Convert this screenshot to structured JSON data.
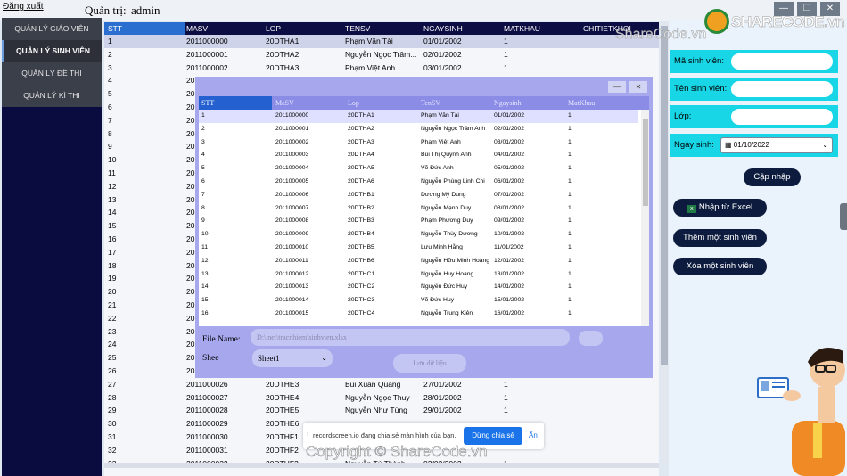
{
  "topbar": {
    "logout": "Đăng xuất",
    "admin_label": "Quản trị:",
    "admin_name": "admin"
  },
  "window_controls": {
    "minimize": "—",
    "restore": "❐",
    "close": "✕"
  },
  "sidebar": {
    "items": [
      {
        "label": "QUẢN LÝ GIÁO VIÊN"
      },
      {
        "label": "QUẢN LÝ SINH VIÊN"
      },
      {
        "label": "QUẢN LÝ ĐỀ THI"
      },
      {
        "label": "QUẢN LÝ KÌ THI"
      }
    ]
  },
  "grid": {
    "columns": [
      "STT",
      "MASV",
      "LOP",
      "TENSV",
      "NGAYSINH",
      "MATKHAU",
      "CHITIETKHOI"
    ],
    "rows": [
      [
        "1",
        "2011000000",
        "20DTHA1",
        "Phạm Văn Tài",
        "01/01/2002",
        "1"
      ],
      [
        "2",
        "2011000001",
        "20DTHA2",
        "Nguyễn Ngọc Trâm...",
        "02/01/2002",
        "1"
      ],
      [
        "3",
        "2011000002",
        "20DTHA3",
        "Phạm Việt Anh",
        "03/01/2002",
        "1"
      ],
      [
        "4",
        "20",
        "",
        "",
        "",
        ""
      ],
      [
        "5",
        "20",
        "",
        "",
        "",
        ""
      ],
      [
        "6",
        "20",
        "",
        "",
        "",
        ""
      ],
      [
        "7",
        "20",
        "",
        "",
        "",
        ""
      ],
      [
        "8",
        "20",
        "",
        "",
        "",
        ""
      ],
      [
        "9",
        "20",
        "",
        "",
        "",
        ""
      ],
      [
        "10",
        "20",
        "",
        "",
        "",
        ""
      ],
      [
        "11",
        "20",
        "",
        "",
        "",
        ""
      ],
      [
        "12",
        "20",
        "",
        "",
        "",
        ""
      ],
      [
        "13",
        "20",
        "",
        "",
        "",
        ""
      ],
      [
        "14",
        "20",
        "",
        "",
        "",
        ""
      ],
      [
        "15",
        "20",
        "",
        "",
        "",
        ""
      ],
      [
        "16",
        "20",
        "",
        "",
        "",
        ""
      ],
      [
        "17",
        "20",
        "",
        "",
        "",
        ""
      ],
      [
        "18",
        "20",
        "",
        "",
        "",
        ""
      ],
      [
        "19",
        "20",
        "",
        "",
        "",
        ""
      ],
      [
        "20",
        "20",
        "",
        "",
        "",
        ""
      ],
      [
        "21",
        "20",
        "",
        "",
        "",
        ""
      ],
      [
        "22",
        "20",
        "",
        "",
        "",
        ""
      ],
      [
        "23",
        "20",
        "",
        "",
        "",
        ""
      ],
      [
        "24",
        "20",
        "",
        "",
        "",
        ""
      ],
      [
        "25",
        "20",
        "",
        "",
        "",
        ""
      ],
      [
        "26",
        "20",
        "",
        "",
        "",
        ""
      ],
      [
        "27",
        "2011000026",
        "20DTHE3",
        "Bùi Xuân Quang",
        "27/01/2002",
        "1"
      ],
      [
        "28",
        "2011000027",
        "20DTHE4",
        "Nguyễn Ngọc Thuy",
        "28/01/2002",
        "1"
      ],
      [
        "29",
        "2011000028",
        "20DTHE5",
        "Nguyễn Như Tùng",
        "29/01/2002",
        "1"
      ],
      [
        "30",
        "2011000029",
        "20DTHE6",
        "",
        "",
        ""
      ],
      [
        "31",
        "2011000030",
        "20DTHF1",
        "",
        "",
        ""
      ],
      [
        "32",
        "2011000031",
        "20DTHF2",
        "",
        "",
        ""
      ],
      [
        "33",
        "2011000032",
        "20DTHF3",
        "Nguyễn Tú Thành",
        "02/02/2002",
        "1"
      ]
    ]
  },
  "form": {
    "masv_label": "Mã sinh viên:",
    "tensv_label": "Tên sinh viên:",
    "lop_label": "Lớp:",
    "ngaysinh_label": "Ngày sinh:",
    "ngaysinh_value": "01/10/2022",
    "update_button": "Cập nhập",
    "import_excel_button": "Nhập từ Excel",
    "add_button": "Thêm một sinh viên",
    "delete_button": "Xóa một sinh viên"
  },
  "dialog": {
    "columns": [
      "STT",
      "MaSV",
      "Lop",
      "TenSV",
      "Ngaysinh",
      "MatKhau"
    ],
    "rows": [
      [
        "1",
        "2011000000",
        "20DTHA1",
        "Phạm Văn Tài",
        "01/01/2002",
        "1"
      ],
      [
        "2",
        "2011000001",
        "20DTHA2",
        "Nguyễn Ngọc Trâm Anh",
        "02/01/2002",
        "1"
      ],
      [
        "3",
        "2011000002",
        "20DTHA3",
        "Phạm Việt Anh",
        "03/01/2002",
        "1"
      ],
      [
        "4",
        "2011000003",
        "20DTHA4",
        "Bùi Thị Quỳnh Anh",
        "04/01/2002",
        "1"
      ],
      [
        "5",
        "2011000004",
        "20DTHA5",
        "Võ Đức Anh",
        "05/01/2002",
        "1"
      ],
      [
        "6",
        "2011000005",
        "20DTHA6",
        "Nguyễn Phùng Linh Chi",
        "06/01/2002",
        "1"
      ],
      [
        "7",
        "2011000006",
        "20DTHB1",
        "Dương Mỹ Dung",
        "07/01/2002",
        "1"
      ],
      [
        "8",
        "2011000007",
        "20DTHB2",
        "Nguyễn Mạnh Duy",
        "08/01/2002",
        "1"
      ],
      [
        "9",
        "2011000008",
        "20DTHB3",
        "Phạm Phương Duy",
        "09/01/2002",
        "1"
      ],
      [
        "10",
        "2011000009",
        "20DTHB4",
        "Nguyễn Thùy Dương",
        "10/01/2002",
        "1"
      ],
      [
        "11",
        "2011000010",
        "20DTHB5",
        "Lưu Minh Hằng",
        "11/01/2002",
        "1"
      ],
      [
        "12",
        "2011000011",
        "20DTHB6",
        "Nguyễn Hữu Minh Hoàng",
        "12/01/2002",
        "1"
      ],
      [
        "13",
        "2011000012",
        "20DTHC1",
        "Nguyễn Huy Hoàng",
        "13/01/2002",
        "1"
      ],
      [
        "14",
        "2011000013",
        "20DTHC2",
        "Nguyễn Đức Huy",
        "14/01/2002",
        "1"
      ],
      [
        "15",
        "2011000014",
        "20DTHC3",
        "Võ Đức Huy",
        "15/01/2002",
        "1"
      ],
      [
        "16",
        "2011000015",
        "20DTHC4",
        "Nguyễn Trung Kiên",
        "16/01/2002",
        "1"
      ]
    ],
    "file_label": "File Name:",
    "file_value": "D:\\.net\\tracnhiem\\sinhvien.xlsx",
    "sheet_label": "Shee",
    "sheet_value": "Sheet1",
    "save_button": "Lưu dữ liệu",
    "minimize": "—",
    "close": "✕"
  },
  "notification": {
    "text": "recordscreen.io đang chia sẻ màn hình của bạn.",
    "stop_button": "Dừng chia sẻ",
    "hide_link": "Ẩn"
  },
  "watermark": {
    "logo_text": "SHARECODE.vn",
    "top_text": "ShareCode.vn",
    "bottom_text": "Copyright © ShareCode.vn"
  }
}
